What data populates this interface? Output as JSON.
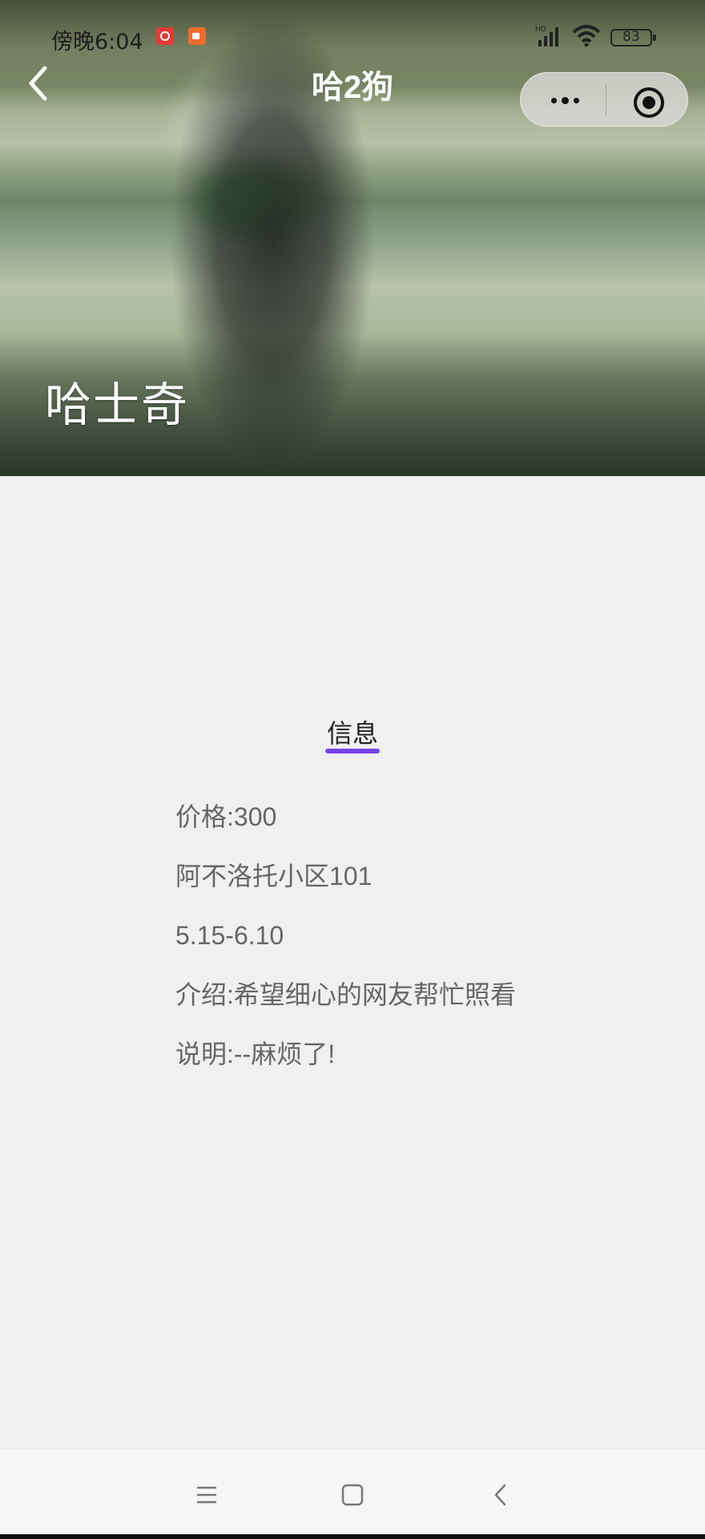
{
  "status_bar": {
    "time": "傍晚6:04",
    "battery": "83",
    "signal_label": "HD"
  },
  "nav": {
    "title": "哈2狗"
  },
  "hero": {
    "title": "哈士奇"
  },
  "tab": {
    "label": "信息",
    "accent_color": "#7444e8"
  },
  "info": {
    "lines": [
      "价格:300",
      "阿不洛托小区101",
      "5.15-6.10",
      "介绍:希望细心的网友帮忙照看",
      "说明:--麻烦了!"
    ]
  },
  "icons": {
    "back": "chevron-left-icon",
    "more": "more-dots-icon",
    "close": "target-circle-icon",
    "menu": "menu-icon",
    "home": "home-square-icon",
    "sys_back": "back-chevron-icon"
  }
}
